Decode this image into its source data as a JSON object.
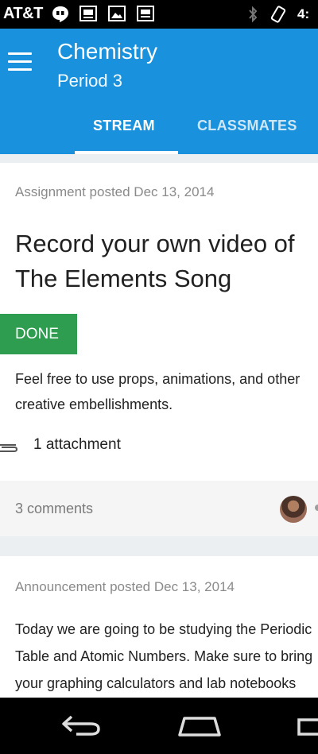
{
  "status_bar": {
    "carrier": "AT&T",
    "time": "4:"
  },
  "app_bar": {
    "title": "Chemistry",
    "subtitle": "Period 3",
    "tabs": [
      {
        "label": "STREAM",
        "active": true
      },
      {
        "label": "CLASSMATES",
        "active": false
      }
    ],
    "color": "#1a91dc"
  },
  "posts": [
    {
      "meta": "Assignment posted Dec 13, 2014",
      "title_lines": [
        "Record your own video of",
        "The Elements Song"
      ],
      "status_button": "DONE",
      "description_lines": [
        "Feel free to use props, animations, and other",
        "creative embellishments."
      ],
      "attachment": "1 attachment",
      "comments": "3 comments"
    },
    {
      "meta": "Announcement posted Dec 13, 2014",
      "body_lines": [
        "Today we are going to be studying the Periodic",
        "Table and Atomic Numbers. Make sure to bring",
        "your graphing calculators and lab notebooks"
      ]
    }
  ],
  "colors": {
    "done_button": "#2e9d4f",
    "background": "#eceff1"
  },
  "icons": {
    "menu": "menu-icon",
    "attachment": "paperclip-icon",
    "back": "back-icon",
    "home": "home-icon",
    "recents": "recents-icon"
  }
}
